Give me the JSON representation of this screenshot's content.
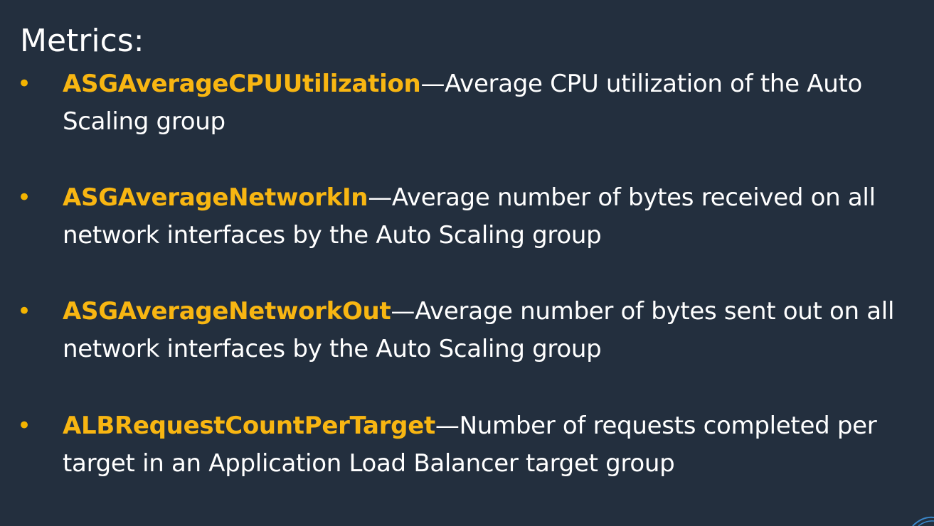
{
  "slide": {
    "title": "Metrics:",
    "bullet_glyph": "•",
    "items": [
      {
        "name": "ASGAverageCPUUtilization",
        "separator": "—",
        "description": "Average CPU utilization of the Auto Scaling group"
      },
      {
        "name": "ASGAverageNetworkIn",
        "separator": "—",
        "description": "Average number of bytes received on all network interfaces by the Auto Scaling group"
      },
      {
        "name": "ASGAverageNetworkOut",
        "separator": "—",
        "description": "Average number of bytes sent out on all network interfaces by the Auto Scaling group"
      },
      {
        "name": "ALBRequestCountPerTarget",
        "separator": "—",
        "description": "Number of requests completed per target in an Application Load Balancer target group"
      }
    ]
  },
  "colors": {
    "background": "#232f3e",
    "accent": "#f8b612",
    "text": "#ffffff"
  }
}
